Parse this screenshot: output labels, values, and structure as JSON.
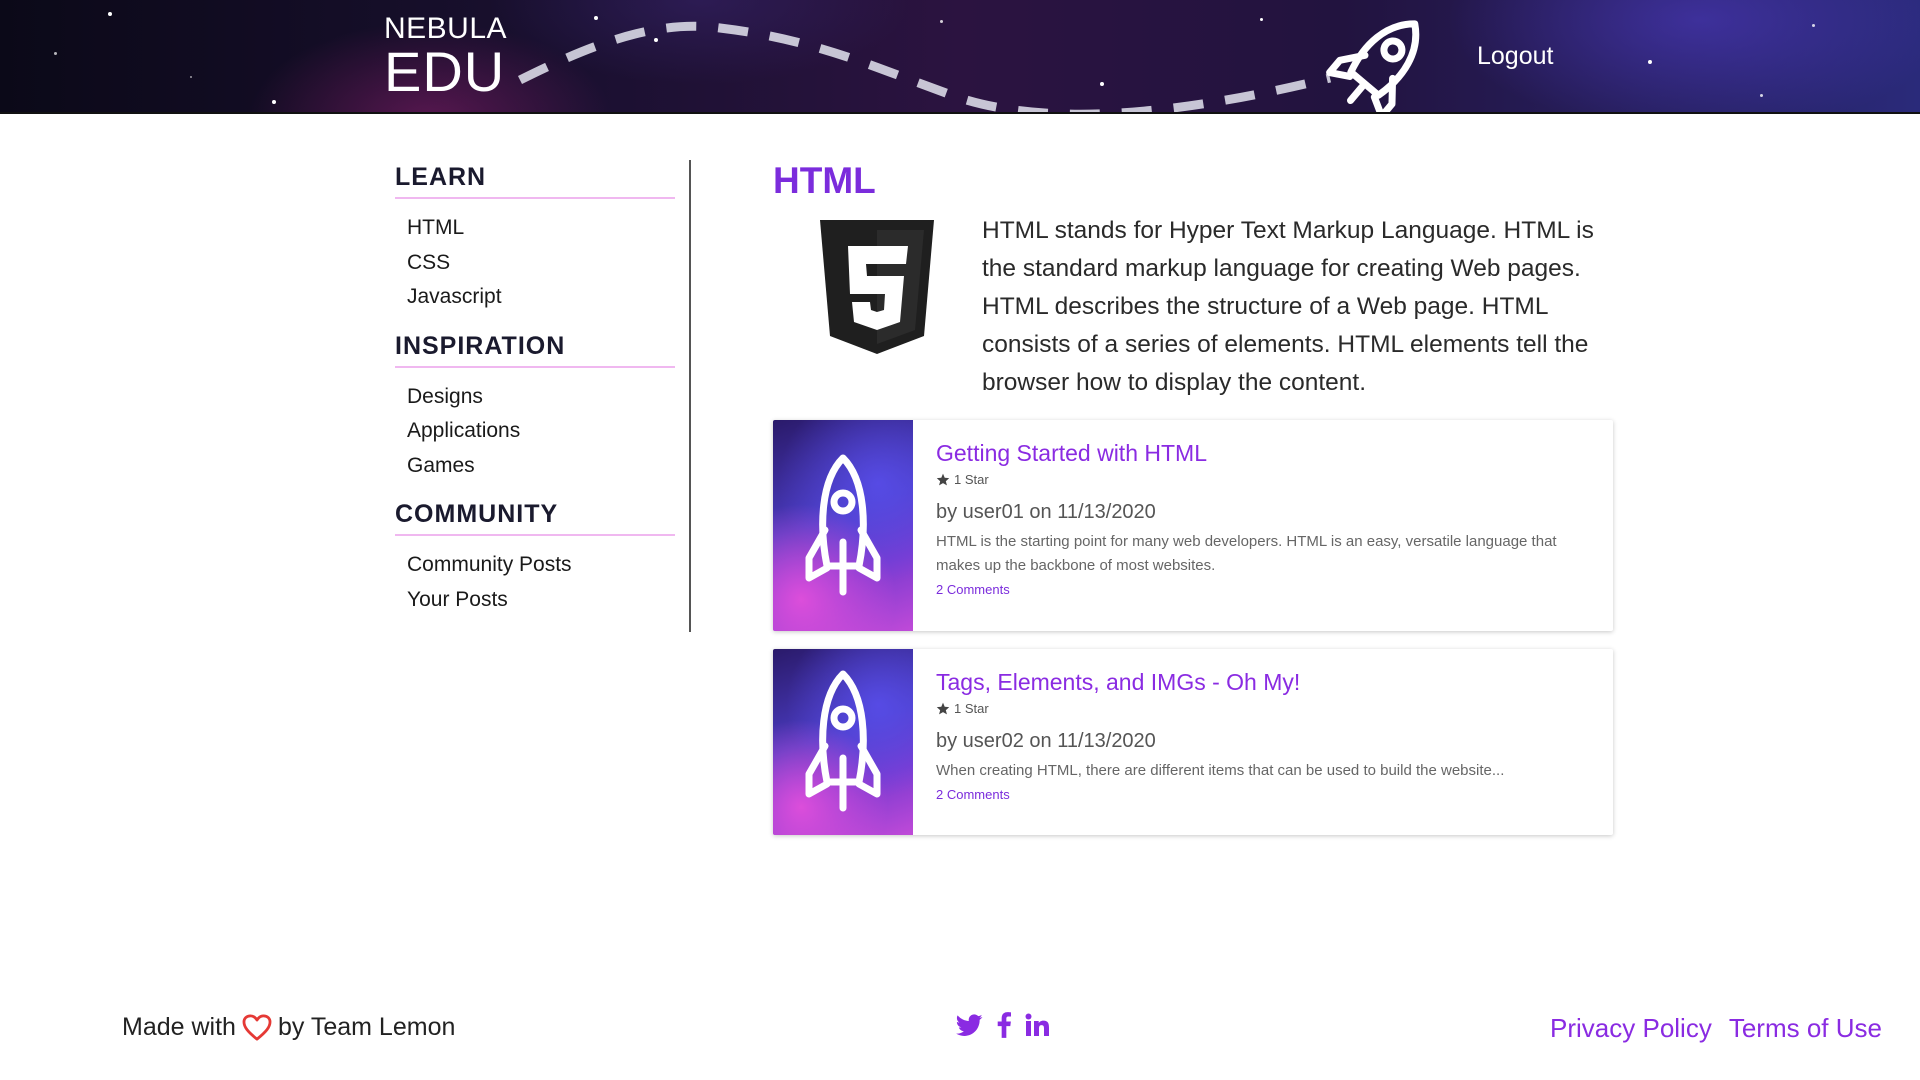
{
  "header": {
    "logo_top": "NEBULA",
    "logo_bottom": "EDU",
    "logout_label": "Logout"
  },
  "sidebar": {
    "sections": [
      {
        "title": "LEARN",
        "items": [
          "HTML",
          "CSS",
          "Javascript"
        ]
      },
      {
        "title": "INSPIRATION",
        "items": [
          "Designs",
          "Applications",
          "Games"
        ]
      },
      {
        "title": "COMMUNITY",
        "items": [
          "Community Posts",
          "Your Posts"
        ]
      }
    ]
  },
  "main": {
    "title": "HTML",
    "intro": "HTML stands for Hyper Text Markup Language. HTML is the standard markup language for creating Web pages. HTML describes the structure of a Web page. HTML consists of a series of elements. HTML elements tell the browser how to display the content.",
    "logo_icon": "html5-icon",
    "posts": [
      {
        "title": "Getting Started with HTML",
        "stars": "1 Star",
        "author": "by user01 on 11/13/2020",
        "description": "HTML is the starting point for many web developers. HTML is an easy, versatile language that makes up the backbone of most websites.",
        "comments": "2 Comments",
        "thumb_icon": "rocket-icon"
      },
      {
        "title": "Tags, Elements, and IMGs - Oh My!",
        "stars": "1 Star",
        "author": "by user02 on 11/13/2020",
        "description": "When creating HTML, there are different items that can be used to build the website...",
        "comments": "2 Comments",
        "thumb_icon": "rocket-icon"
      }
    ]
  },
  "footer": {
    "made_with": "Made with",
    "by_team": "by Team Lemon",
    "social_icons": [
      "twitter-icon",
      "facebook-icon",
      "linkedin-icon"
    ],
    "links": [
      "Privacy Policy",
      "Terms of Use"
    ]
  },
  "colors": {
    "accent": "#8a2be2",
    "heart": "#e53935",
    "divider": "#f0b8f0"
  }
}
